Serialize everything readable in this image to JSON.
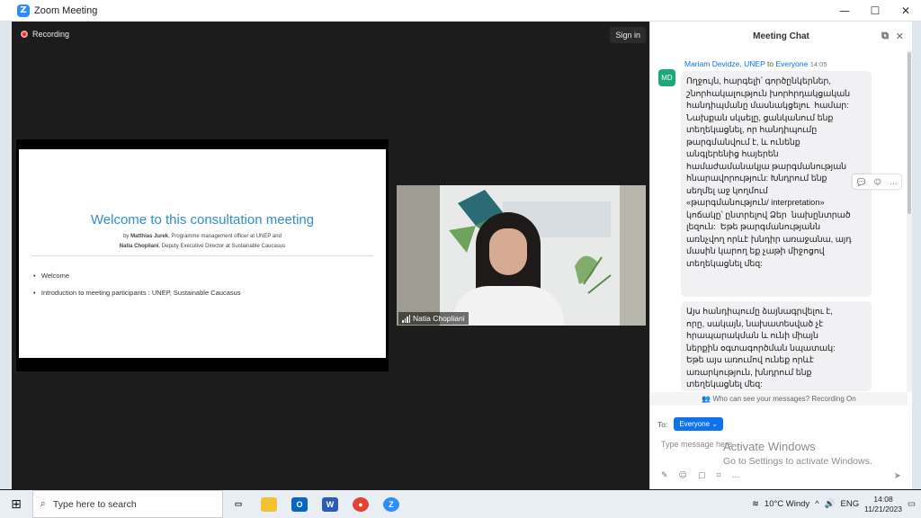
{
  "window": {
    "title": "Zoom Meeting",
    "logo": "Z",
    "minimize": "—",
    "maximize": "☐",
    "close": "✕"
  },
  "meeting": {
    "recording_label": "Recording",
    "signin_label": "Sign in",
    "slide": {
      "title": "Welcome to this consultation meeting",
      "line1_prefix": "by ",
      "line1_name": "Matthias Jurek",
      "line1_rest": ", Programme management officer at UNEP and",
      "line2_name": "Natia Chopliani",
      "line2_rest": ", Deputy Executive Director at Sustainable Caucasus",
      "bullets": [
        "Welcome",
        "Introduction to meeting participants : UNEP, Sustainable Caucasus"
      ]
    },
    "video": {
      "participant_name": "Natia Chopliani"
    }
  },
  "chat": {
    "title": "Meeting Chat",
    "sender": "Mariam Devidze, UNEP",
    "to_word": "to",
    "recipient": "Everyone",
    "time": "14:05",
    "avatar_initials": "MD",
    "message1": "Ողջույն, հարգելի՛ գործընկերներ,\nշնորհակալություն խորհրդակցական\nհանդիպմանը մասնակցելու  համար:\nՆախքան սկսելը, ցանկանում ենք\nտեղեկացնել, որ հանդիպումը\nթարգմանվում է, և ունենք\nանգլերենից հայերեն\nհամաժամանակյա թարգմանության\nհնարավորություն: Խնդրում ենք\nսեղմել աջ կողմում\n«թարգմանություն/ interpretation»\nկոճակը՝ ընտրելով Ձեր  նախընտրած\nլեզուն:  Եթե թարգմանությանն\nառնչվող որևէ խնդիր առաջանա, այդ\nմասին կարող եք չաթի միջոցով\nտեղեկացնել մեզ:",
    "message2": "Այս հանդիպումը ձայնագրվելու է,\nորը, սակայն, նախատեսված չէ\nհրապարակման և ունի միայն\nներքին օգտագործման նպատակ:\nԵթե այս առումով ունեք որևէ\nառարկություն, խնդրում ենք\nտեղեկացնել մեզ:",
    "recording_note": "Who can see your messages? Recording On",
    "to_label": "To:",
    "to_value": "Everyone",
    "input_placeholder": "Type message here..."
  },
  "watermark": {
    "line1": "Activate Windows",
    "line2": "Go to Settings to activate Windows."
  },
  "taskbar": {
    "search_placeholder": "Type here to search",
    "weather": "10°C  Windy",
    "language": "ENG",
    "time": "14:08",
    "date": "11/21/2023"
  },
  "colors": {
    "accent": "#0e72ed",
    "slide_title": "#2f8fc9",
    "avatar": "#1aa97a",
    "record": "#e02f2f"
  }
}
